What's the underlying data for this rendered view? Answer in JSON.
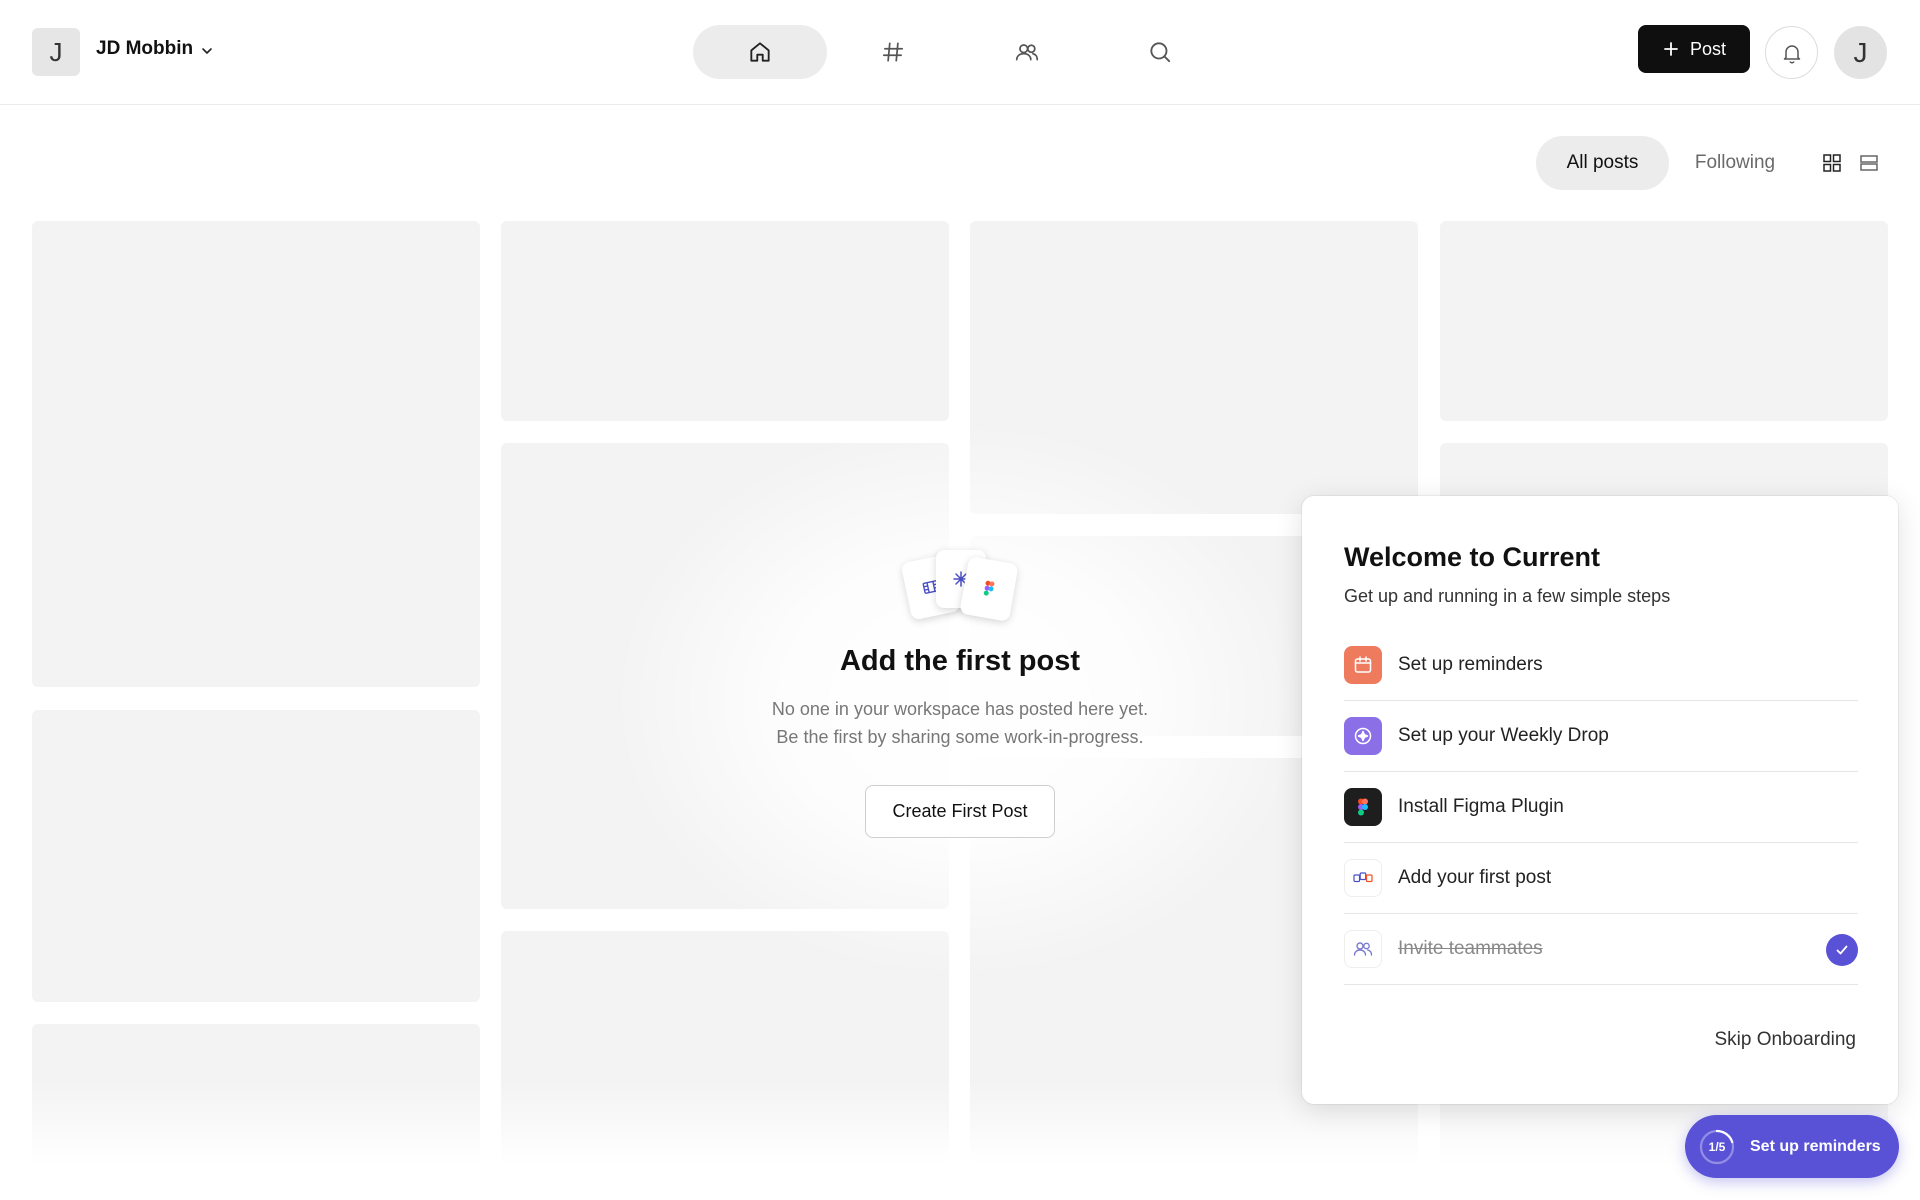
{
  "workspace": {
    "initial": "J",
    "name": "JD Mobbin"
  },
  "nav": {
    "items": [
      {
        "icon": "home-icon",
        "active": true
      },
      {
        "icon": "hash-icon",
        "active": false
      },
      {
        "icon": "people-icon",
        "active": false
      },
      {
        "icon": "search-icon",
        "active": false
      }
    ]
  },
  "header": {
    "post_label": "Post",
    "user_initial": "J"
  },
  "filters": {
    "all_posts": "All posts",
    "following": "Following"
  },
  "empty_state": {
    "title": "Add the first post",
    "line1": "No one in your workspace has posted here yet.",
    "line2": "Be the first by sharing some work-in-progress.",
    "button": "Create First Post"
  },
  "onboarding": {
    "title": "Welcome to Current",
    "subtitle": "Get up and running in a few simple steps",
    "steps": [
      {
        "label": "Set up reminders",
        "icon": "calendar-icon",
        "done": false
      },
      {
        "label": "Set up your Weekly Drop",
        "icon": "sparkle-icon",
        "done": false
      },
      {
        "label": "Install Figma Plugin",
        "icon": "figma-icon",
        "done": false
      },
      {
        "label": "Add your first post",
        "icon": "post-cards-icon",
        "done": false
      },
      {
        "label": "Invite teammates",
        "icon": "people-icon",
        "done": true
      }
    ],
    "skip_label": "Skip Onboarding"
  },
  "progress": {
    "counter": "1/5",
    "completed": 1,
    "total": 5,
    "label": "Set up reminders"
  },
  "colors": {
    "accent": "#5a52d6",
    "post_button": "#0f0f0f",
    "placeholder": "#f3f3f3",
    "reminders_icon": "#ef7b5f",
    "weekly_drop_icon": "#8b6fe6",
    "figma_icon_bg": "#1e1e1e"
  }
}
